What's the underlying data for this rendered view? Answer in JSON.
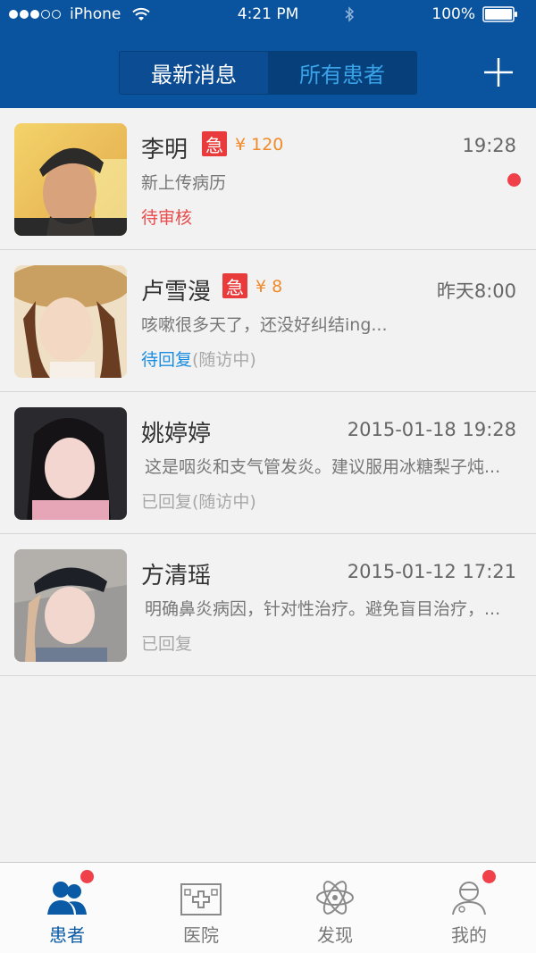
{
  "status_bar": {
    "carrier": "iPhone",
    "time": "4:21 PM",
    "battery": "100%"
  },
  "header": {
    "tabs": [
      {
        "label": "最新消息",
        "active": true
      },
      {
        "label": "所有患者",
        "active": false
      }
    ],
    "add_icon": "plus-icon"
  },
  "patients": [
    {
      "name": "李明",
      "urgent_badge": "急",
      "price": "¥ 120",
      "time": "19:28",
      "preview": "新上传病历",
      "status": "待审核",
      "unread": true
    },
    {
      "name": "卢雪漫",
      "urgent_badge": "急",
      "price": "¥ 8",
      "time": "昨天8:00",
      "preview": "咳嗽很多天了，还没好纠结ing...",
      "status": "待回复",
      "status_extra": "(随访中)"
    },
    {
      "name": "姚婷婷",
      "time": "2015-01-18  19:28",
      "preview": "这是咽炎和支气管发炎。建议服用冰糖梨子炖...",
      "status": "已回复(随访中)"
    },
    {
      "name": "方清瑶",
      "time": "2015-01-12  17:21",
      "preview": "明确鼻炎病因，针对性治疗。避免盲目治疗，...",
      "status": "已回复"
    }
  ],
  "tabbar": {
    "items": [
      {
        "label": "患者",
        "icon": "patients-icon",
        "active": true,
        "badge": true
      },
      {
        "label": "医院",
        "icon": "hospital-icon",
        "active": false,
        "badge": false
      },
      {
        "label": "发现",
        "icon": "atom-icon",
        "active": false,
        "badge": false
      },
      {
        "label": "我的",
        "icon": "doctor-icon",
        "active": false,
        "badge": true
      }
    ]
  },
  "colors": {
    "header_bg": "#0a549f",
    "urgent_red": "#e93b3b",
    "price_orange": "#f08a2a",
    "status_red": "#e94a4a",
    "status_blue": "#1a8de0",
    "badge_red": "#f0414b"
  }
}
